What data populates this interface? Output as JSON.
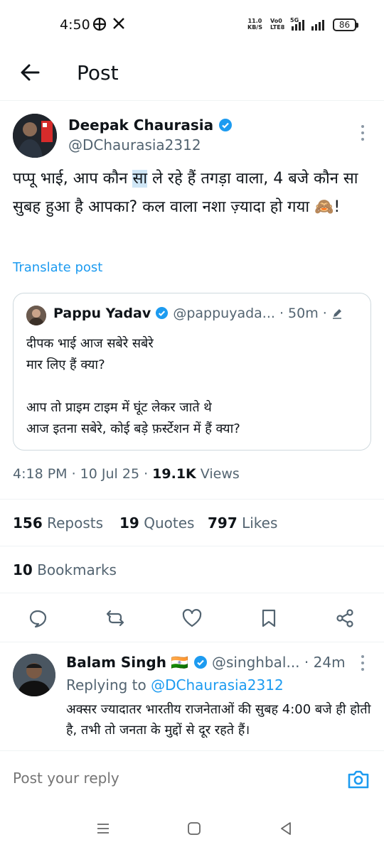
{
  "status_bar": {
    "time": "4:50",
    "net_speed_value": "11.0",
    "net_speed_unit": "KB/S",
    "volte_line1": "Vo0",
    "volte_line2": "LTE8",
    "network_type": "5G",
    "battery": "86"
  },
  "header": {
    "title": "Post"
  },
  "post": {
    "author_name": "Deepak Chaurasia",
    "author_handle": "@DChaurasia2312",
    "text_before": "पप्पू भाई, आप कौन ",
    "text_highlight": "सा",
    "text_after": " ले रहे हैं तगड़ा वाला, 4 बजे कौन सा सुबह हुआ है आपका? कल वाला नशा ज़्यादा हो गया 🙈!",
    "translate_label": "Translate post",
    "timestamp": "4:18 PM · 10 Jul 25 · ",
    "views_count": "19.1K",
    "views_label": " Views"
  },
  "quote": {
    "name": "Pappu Yadav",
    "handle": "@pappuyada...",
    "time": " · 50m · ",
    "text": "दीपक भाई आज सबेरे सबेरे\nमार लिए हैं क्या?\n\nआप तो प्राइम टाइम में घूंट लेकर जाते थे\nआज इतना सबेरे, कोई बड़े फ़र्स्टेशन में हैं क्या?"
  },
  "stats": {
    "reposts_count": "156",
    "reposts_label": " Reposts",
    "quotes_count": "19",
    "quotes_label": " Quotes",
    "likes_count": "797",
    "likes_label": " Likes",
    "bookmarks_count": "10",
    "bookmarks_label": " Bookmarks"
  },
  "actions": [
    "reply-icon",
    "repost-icon",
    "like-icon",
    "bookmark-icon",
    "share-icon"
  ],
  "reply": {
    "name": "Balam Singh",
    "flag": "🇮🇳",
    "handle": "@singhbal...",
    "time": " · 24m",
    "replying_prefix": "Replying to ",
    "replying_to": "@DChaurasia2312",
    "text": "अक्सर ज्यादातर भारतीय राजनेताओं की सुबह 4:00 बजे ही होती है, तभी तो जनता के मुद्दों से दूर रहते हैं।"
  },
  "compose": {
    "placeholder": "Post your reply"
  },
  "colors": {
    "accent": "#1d9bf0",
    "text": "#0f1419",
    "secondary": "#536471",
    "border": "#cfd9de"
  }
}
